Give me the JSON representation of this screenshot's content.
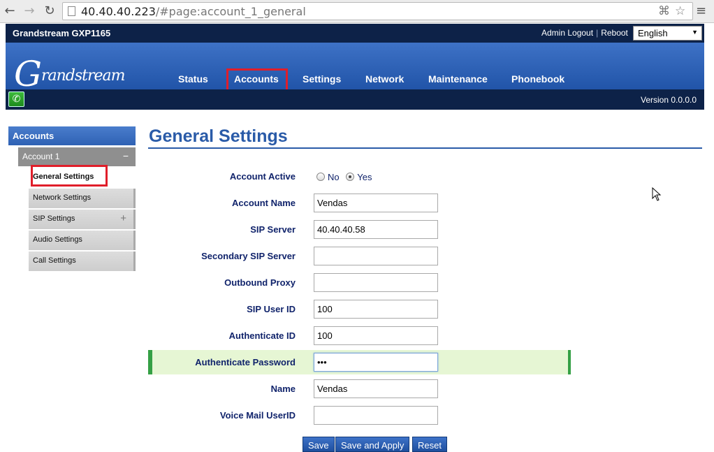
{
  "browser": {
    "url_host": "40.40.40.223",
    "url_path": "/#page:account_1_general"
  },
  "header": {
    "device_name": "Grandstream GXP1165",
    "admin_logout": "Admin Logout",
    "reboot": "Reboot",
    "language": "English",
    "logo_text": "Grandstream",
    "logo_initial": "G",
    "logo_rest": "randstream",
    "version": "Version 0.0.0.0"
  },
  "nav": {
    "tabs": [
      {
        "label": "Status"
      },
      {
        "label": "Accounts",
        "active": true
      },
      {
        "label": "Settings"
      },
      {
        "label": "Network"
      },
      {
        "label": "Maintenance"
      },
      {
        "label": "Phonebook"
      }
    ]
  },
  "sidebar": {
    "section": "Accounts",
    "account": "Account 1",
    "collapse_symbol": "−",
    "expand_symbol": "+",
    "items": [
      {
        "label": "General Settings",
        "active": true
      },
      {
        "label": "Network Settings"
      },
      {
        "label": "SIP Settings"
      },
      {
        "label": "Audio Settings"
      },
      {
        "label": "Call Settings"
      }
    ]
  },
  "main": {
    "title": "General Settings",
    "account_active": {
      "label": "Account Active",
      "options": [
        "No",
        "Yes"
      ],
      "selected": "Yes"
    },
    "fields": [
      {
        "label": "Account Name",
        "value": "Vendas"
      },
      {
        "label": "SIP Server",
        "value": "40.40.40.58"
      },
      {
        "label": "Secondary SIP Server",
        "value": ""
      },
      {
        "label": "Outbound Proxy",
        "value": ""
      },
      {
        "label": "SIP User ID",
        "value": "100"
      },
      {
        "label": "Authenticate ID",
        "value": "100"
      },
      {
        "label": "Authenticate Password",
        "value": "•••"
      },
      {
        "label": "Name",
        "value": "Vendas"
      },
      {
        "label": "Voice Mail UserID",
        "value": ""
      }
    ],
    "buttons": {
      "save": "Save",
      "save_apply": "Save and Apply",
      "reset": "Reset"
    }
  },
  "colors": {
    "header_dark": "#0d2248",
    "header_blue": "#2154a8",
    "highlight_red": "#e01e2a",
    "title_blue": "#2a5ba8",
    "row_highlight": "#e6f6d4",
    "row_border": "#35a045"
  }
}
